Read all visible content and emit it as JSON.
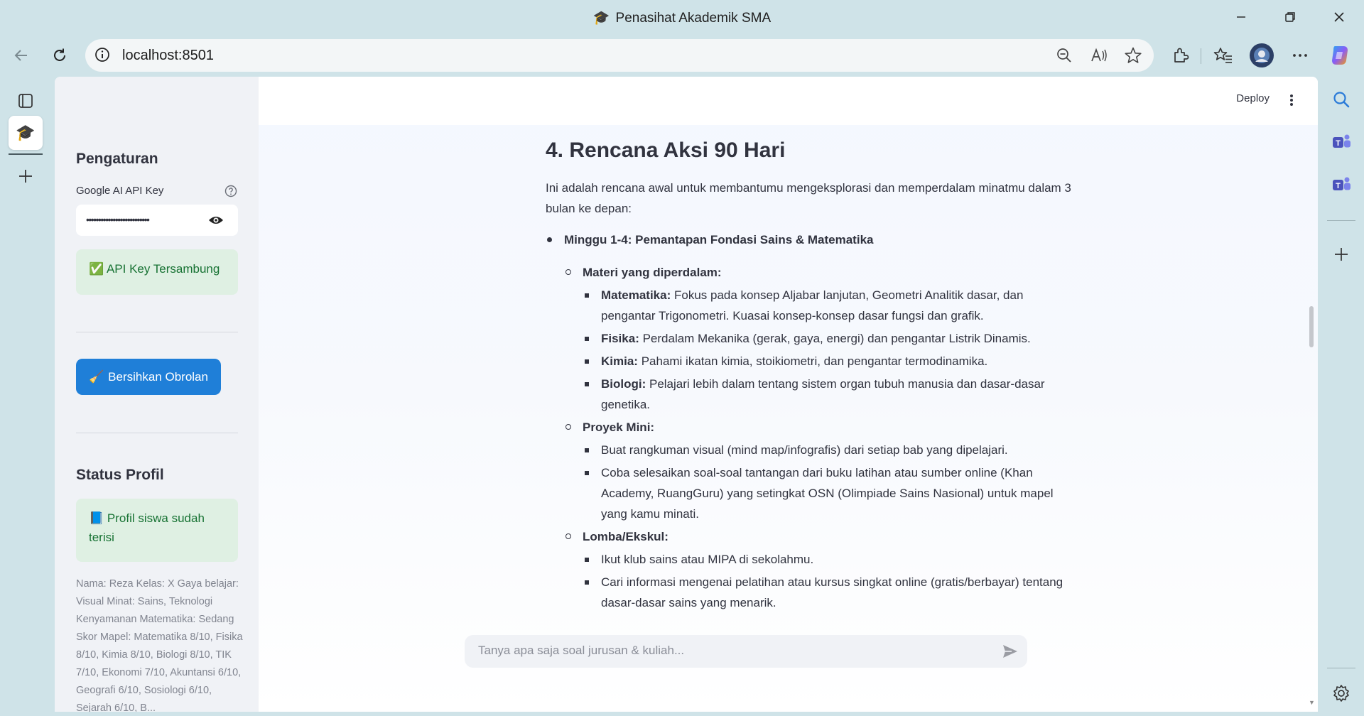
{
  "browser": {
    "window_title": "Penasihat Akademik SMA",
    "title_icon": "🎓",
    "url": "localhost:8501"
  },
  "app": {
    "header": {
      "deploy_label": "Deploy"
    },
    "sidebar": {
      "settings_title": "Pengaturan",
      "api_key_label": "Google AI API Key",
      "api_key_value": "••••••••••••••••••••••••••",
      "api_status": "✅ API Key Tersambung",
      "clear_button_icon": "🧹",
      "clear_button_label": "Bersihkan Obrolan",
      "profile_title": "Status Profil",
      "profile_status": "📘 Profil siswa sudah terisi",
      "profile_summary": "Nama: Reza Kelas: X Gaya belajar: Visual Minat: Sains, Teknologi Kenyamanan Matematika: Sedang Skor Mapel: Matematika 8/10, Fisika 8/10, Kimia 8/10, Biologi 8/10, TIK 7/10, Ekonomi 7/10, Akuntansi 6/10, Geografi 6/10, Sosiologi 6/10, Sejarah 6/10, B..."
    },
    "main": {
      "heading": "4. Rencana Aksi 90 Hari",
      "intro": "Ini adalah rencana awal untuk membantumu mengeksplorasi dan memperdalam minatmu dalam 3 bulan ke depan:",
      "week_title": "Minggu 1-4: Pemantapan Fondasi Sains & Matematika",
      "materi": {
        "title": "Materi yang diperdalam:",
        "items": [
          {
            "subject": "Matematika:",
            "text": " Fokus pada konsep Aljabar lanjutan, Geometri Analitik dasar, dan pengantar Trigonometri. Kuasai konsep-konsep dasar fungsi dan grafik."
          },
          {
            "subject": "Fisika:",
            "text": " Perdalam Mekanika (gerak, gaya, energi) dan pengantar Listrik Dinamis."
          },
          {
            "subject": "Kimia:",
            "text": " Pahami ikatan kimia, stoikiometri, dan pengantar termodinamika."
          },
          {
            "subject": "Biologi:",
            "text": " Pelajari lebih dalam tentang sistem organ tubuh manusia dan dasar-dasar genetika."
          }
        ]
      },
      "proyek": {
        "title": "Proyek Mini:",
        "items": [
          "Buat rangkuman visual (mind map/infografis) dari setiap bab yang dipelajari.",
          "Coba selesaikan soal-soal tantangan dari buku latihan atau sumber online (Khan Academy, RuangGuru) yang setingkat OSN (Olimpiade Sains Nasional) untuk mapel yang kamu minati."
        ]
      },
      "lomba": {
        "title": "Lomba/Ekskul:",
        "items": [
          "Ikut klub sains atau MIPA di sekolahmu.",
          "Cari informasi mengenai pelatihan atau kursus singkat online (gratis/berbayar) tentang dasar-dasar sains yang menarik."
        ]
      },
      "chat_placeholder": "Tanya apa saja soal jurusan & kuliah..."
    }
  }
}
